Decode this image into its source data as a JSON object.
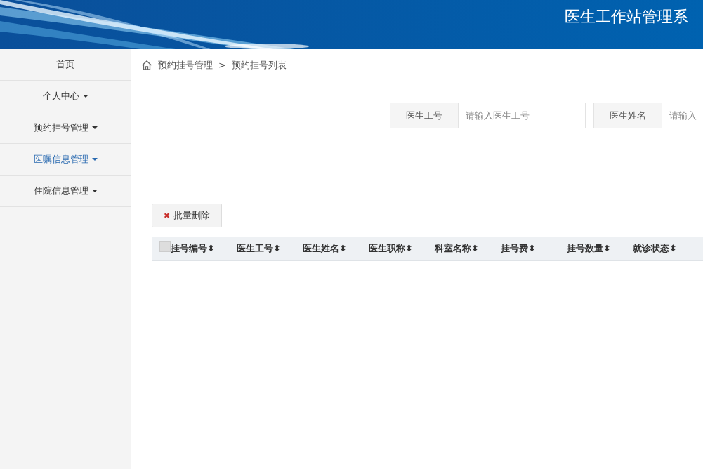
{
  "header": {
    "title": "医生工作站管理系"
  },
  "sidebar": {
    "items": [
      {
        "label": "首页",
        "dropdown": false,
        "selected": false
      },
      {
        "label": "个人中心",
        "dropdown": true,
        "selected": false
      },
      {
        "label": "预约挂号管理",
        "dropdown": true,
        "selected": false
      },
      {
        "label": "医嘱信息管理",
        "dropdown": true,
        "selected": true
      },
      {
        "label": "住院信息管理",
        "dropdown": true,
        "selected": false
      }
    ]
  },
  "breadcrumb": {
    "items": [
      "预约挂号管理",
      "预约挂号列表"
    ],
    "separator": ">"
  },
  "search": {
    "fields": [
      {
        "label": "医生工号",
        "placeholder": "请输入医生工号"
      },
      {
        "label": "医生姓名",
        "placeholder": "请输入"
      }
    ]
  },
  "toolbar": {
    "delete_button": {
      "icon": "✖",
      "label": "批量删除"
    }
  },
  "table": {
    "select_all_checked": false,
    "columns": [
      "挂号编号",
      "医生工号",
      "医生姓名",
      "医生职称",
      "科室名称",
      "挂号费",
      "挂号数量",
      "就诊状态"
    ],
    "sort_icon": "⬍"
  }
}
